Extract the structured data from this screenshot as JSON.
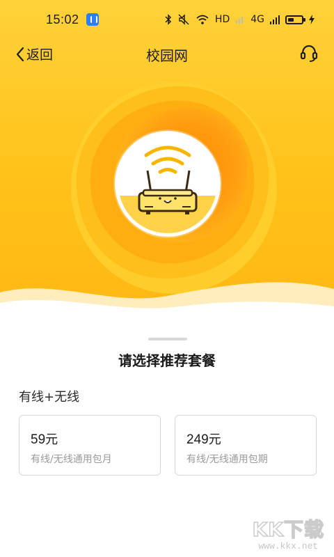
{
  "status_bar": {
    "time": "15:02",
    "network_label": "HD",
    "signal_label": "4G",
    "icons": [
      "bluetooth-icon",
      "mute-icon",
      "wifi-icon",
      "signal-icon",
      "battery-icon",
      "charging-icon"
    ]
  },
  "nav": {
    "back_label": "返回",
    "title": "校园网",
    "support_icon": "headset-icon"
  },
  "hero": {
    "illustration": "router-wifi-icon",
    "colors": {
      "primary": "#ffc21a",
      "accent": "#ff8a00"
    }
  },
  "sheet": {
    "title": "请选择推荐套餐",
    "group_label": "有线+无线",
    "plans": [
      {
        "price": "59",
        "unit": "元",
        "desc": "有线/无线通用包月"
      },
      {
        "price": "249",
        "unit": "元",
        "desc": "有线/无线通用包期"
      }
    ]
  },
  "watermark": {
    "main": "KK下载",
    "sub": "www.kkx.net"
  }
}
